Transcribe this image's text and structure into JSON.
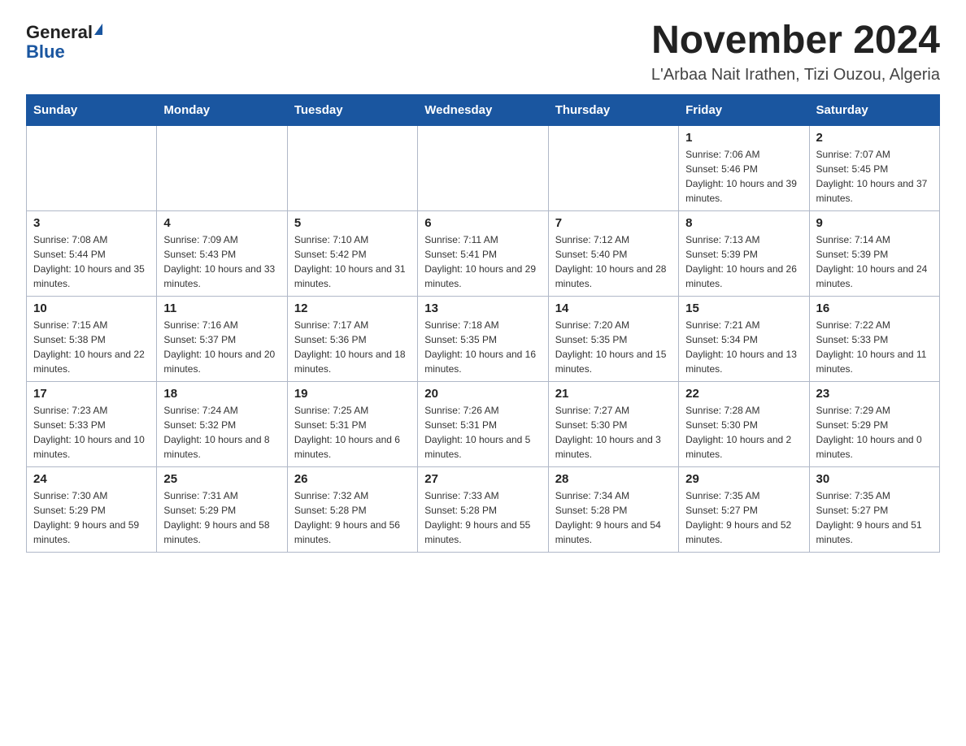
{
  "logo": {
    "general": "General",
    "blue": "Blue"
  },
  "title": "November 2024",
  "subtitle": "L'Arbaa Nait Irathen, Tizi Ouzou, Algeria",
  "weekdays": [
    "Sunday",
    "Monday",
    "Tuesday",
    "Wednesday",
    "Thursday",
    "Friday",
    "Saturday"
  ],
  "weeks": [
    [
      {
        "day": "",
        "info": ""
      },
      {
        "day": "",
        "info": ""
      },
      {
        "day": "",
        "info": ""
      },
      {
        "day": "",
        "info": ""
      },
      {
        "day": "",
        "info": ""
      },
      {
        "day": "1",
        "info": "Sunrise: 7:06 AM\nSunset: 5:46 PM\nDaylight: 10 hours and 39 minutes."
      },
      {
        "day": "2",
        "info": "Sunrise: 7:07 AM\nSunset: 5:45 PM\nDaylight: 10 hours and 37 minutes."
      }
    ],
    [
      {
        "day": "3",
        "info": "Sunrise: 7:08 AM\nSunset: 5:44 PM\nDaylight: 10 hours and 35 minutes."
      },
      {
        "day": "4",
        "info": "Sunrise: 7:09 AM\nSunset: 5:43 PM\nDaylight: 10 hours and 33 minutes."
      },
      {
        "day": "5",
        "info": "Sunrise: 7:10 AM\nSunset: 5:42 PM\nDaylight: 10 hours and 31 minutes."
      },
      {
        "day": "6",
        "info": "Sunrise: 7:11 AM\nSunset: 5:41 PM\nDaylight: 10 hours and 29 minutes."
      },
      {
        "day": "7",
        "info": "Sunrise: 7:12 AM\nSunset: 5:40 PM\nDaylight: 10 hours and 28 minutes."
      },
      {
        "day": "8",
        "info": "Sunrise: 7:13 AM\nSunset: 5:39 PM\nDaylight: 10 hours and 26 minutes."
      },
      {
        "day": "9",
        "info": "Sunrise: 7:14 AM\nSunset: 5:39 PM\nDaylight: 10 hours and 24 minutes."
      }
    ],
    [
      {
        "day": "10",
        "info": "Sunrise: 7:15 AM\nSunset: 5:38 PM\nDaylight: 10 hours and 22 minutes."
      },
      {
        "day": "11",
        "info": "Sunrise: 7:16 AM\nSunset: 5:37 PM\nDaylight: 10 hours and 20 minutes."
      },
      {
        "day": "12",
        "info": "Sunrise: 7:17 AM\nSunset: 5:36 PM\nDaylight: 10 hours and 18 minutes."
      },
      {
        "day": "13",
        "info": "Sunrise: 7:18 AM\nSunset: 5:35 PM\nDaylight: 10 hours and 16 minutes."
      },
      {
        "day": "14",
        "info": "Sunrise: 7:20 AM\nSunset: 5:35 PM\nDaylight: 10 hours and 15 minutes."
      },
      {
        "day": "15",
        "info": "Sunrise: 7:21 AM\nSunset: 5:34 PM\nDaylight: 10 hours and 13 minutes."
      },
      {
        "day": "16",
        "info": "Sunrise: 7:22 AM\nSunset: 5:33 PM\nDaylight: 10 hours and 11 minutes."
      }
    ],
    [
      {
        "day": "17",
        "info": "Sunrise: 7:23 AM\nSunset: 5:33 PM\nDaylight: 10 hours and 10 minutes."
      },
      {
        "day": "18",
        "info": "Sunrise: 7:24 AM\nSunset: 5:32 PM\nDaylight: 10 hours and 8 minutes."
      },
      {
        "day": "19",
        "info": "Sunrise: 7:25 AM\nSunset: 5:31 PM\nDaylight: 10 hours and 6 minutes."
      },
      {
        "day": "20",
        "info": "Sunrise: 7:26 AM\nSunset: 5:31 PM\nDaylight: 10 hours and 5 minutes."
      },
      {
        "day": "21",
        "info": "Sunrise: 7:27 AM\nSunset: 5:30 PM\nDaylight: 10 hours and 3 minutes."
      },
      {
        "day": "22",
        "info": "Sunrise: 7:28 AM\nSunset: 5:30 PM\nDaylight: 10 hours and 2 minutes."
      },
      {
        "day": "23",
        "info": "Sunrise: 7:29 AM\nSunset: 5:29 PM\nDaylight: 10 hours and 0 minutes."
      }
    ],
    [
      {
        "day": "24",
        "info": "Sunrise: 7:30 AM\nSunset: 5:29 PM\nDaylight: 9 hours and 59 minutes."
      },
      {
        "day": "25",
        "info": "Sunrise: 7:31 AM\nSunset: 5:29 PM\nDaylight: 9 hours and 58 minutes."
      },
      {
        "day": "26",
        "info": "Sunrise: 7:32 AM\nSunset: 5:28 PM\nDaylight: 9 hours and 56 minutes."
      },
      {
        "day": "27",
        "info": "Sunrise: 7:33 AM\nSunset: 5:28 PM\nDaylight: 9 hours and 55 minutes."
      },
      {
        "day": "28",
        "info": "Sunrise: 7:34 AM\nSunset: 5:28 PM\nDaylight: 9 hours and 54 minutes."
      },
      {
        "day": "29",
        "info": "Sunrise: 7:35 AM\nSunset: 5:27 PM\nDaylight: 9 hours and 52 minutes."
      },
      {
        "day": "30",
        "info": "Sunrise: 7:35 AM\nSunset: 5:27 PM\nDaylight: 9 hours and 51 minutes."
      }
    ]
  ]
}
